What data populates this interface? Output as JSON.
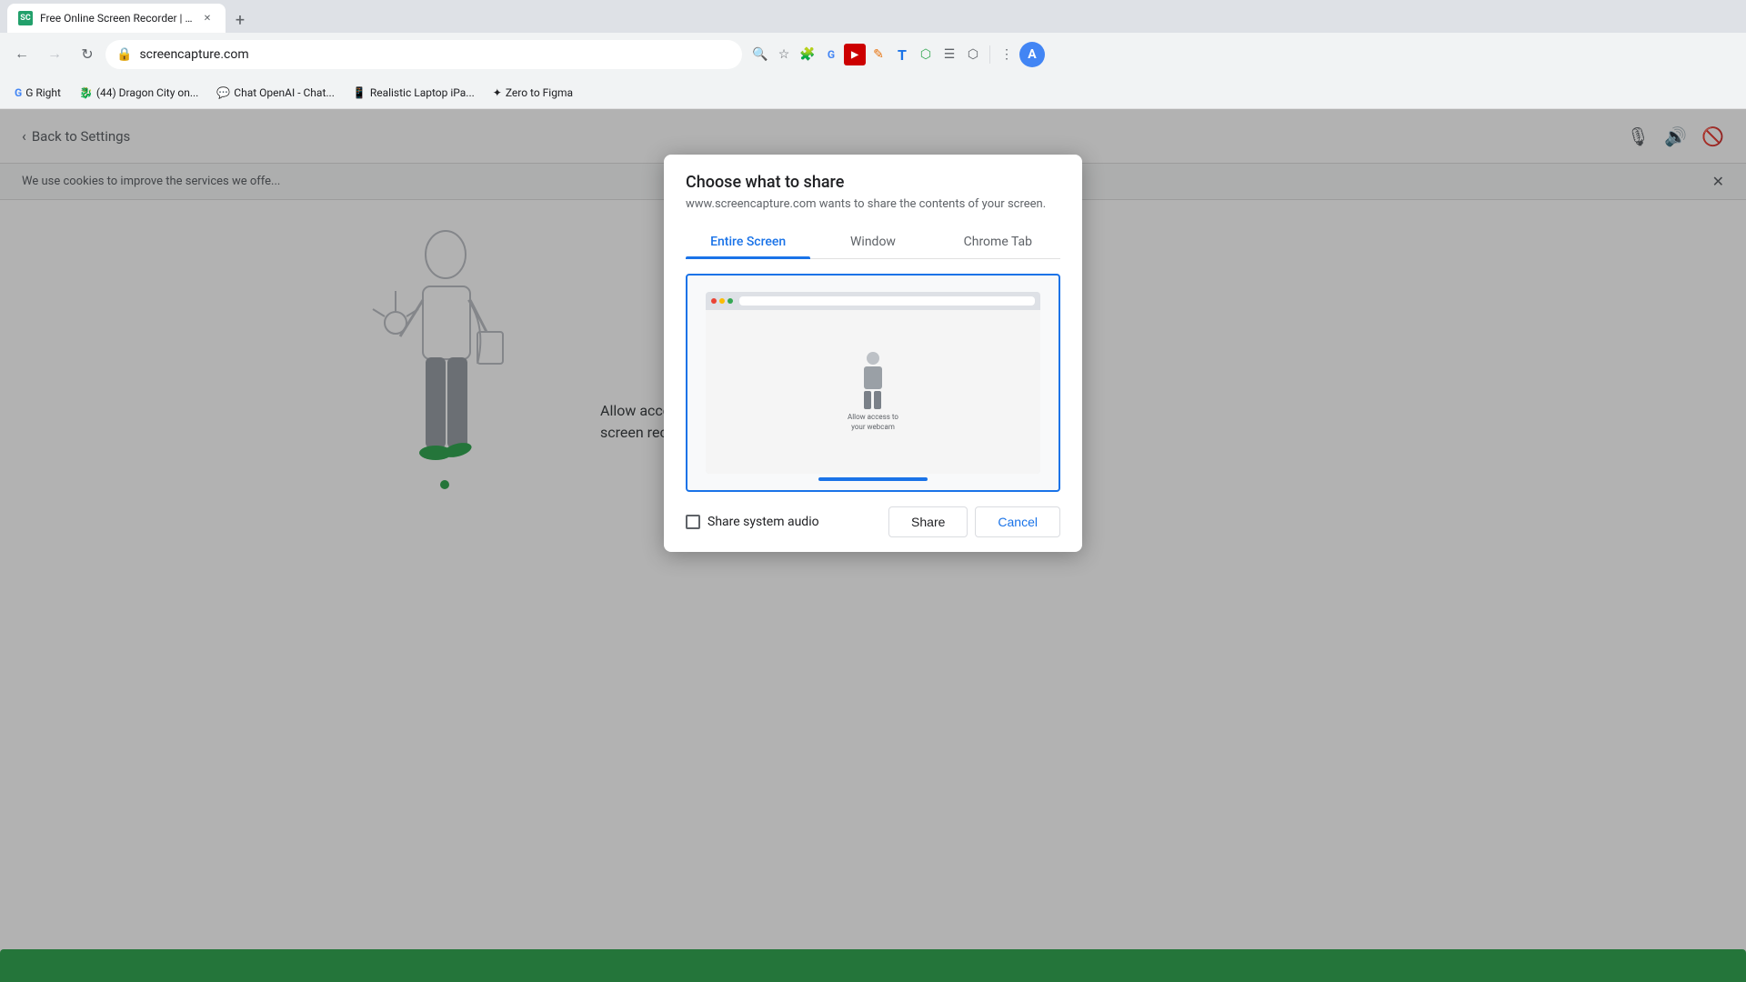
{
  "browser": {
    "tab": {
      "title": "Free Online Screen Recorder | O...",
      "favicon_label": "SC",
      "favicon_bg": "#22a06b"
    },
    "new_tab_label": "+",
    "address": "screencapture.com",
    "back_label": "←",
    "forward_label": "→",
    "reload_label": "↻"
  },
  "bookmarks": [
    {
      "label": "G Right",
      "icon": "G"
    },
    {
      "label": "(44) Dragon City on...",
      "icon": "🐉"
    },
    {
      "label": "Chat OpenAI - Chat...",
      "icon": "💬"
    },
    {
      "label": "Realistic Laptop iPa...",
      "icon": "📱"
    },
    {
      "label": "Zero to Figma",
      "icon": "✦"
    }
  ],
  "site": {
    "back_link": "Back to Settings",
    "back_arrow": "‹",
    "cookie_banner": "We use cookies to improve the services we offe...",
    "main_text_line1": "Allow access to your webcam and mic to start",
    "main_text_line2": "screen recording.",
    "bottom_bar_color": "#34a853"
  },
  "dialog": {
    "title": "Choose what to share",
    "subtitle": "www.screencapture.com wants to share the contents of your screen.",
    "tabs": [
      {
        "label": "Entire Screen",
        "active": true
      },
      {
        "label": "Window",
        "active": false
      },
      {
        "label": "Chrome Tab",
        "active": false
      }
    ],
    "share_audio_label": "Share system audio",
    "share_btn": "Share",
    "cancel_btn": "Cancel",
    "selection_indicator_color": "#1a73e8"
  },
  "icons": {
    "microphone": "🎙",
    "speaker": "🔊",
    "block": "🚫",
    "search": "🔍",
    "bookmark": "☆",
    "user_menu": "⋮",
    "close": "✕",
    "extensions": "🧩",
    "profile_label": "A"
  }
}
